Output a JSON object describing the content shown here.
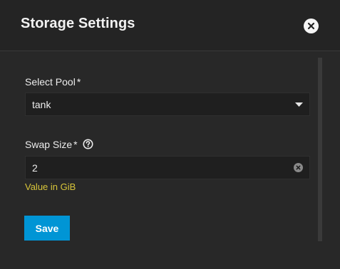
{
  "header": {
    "title": "Storage Settings",
    "close_icon": "close-circle-icon"
  },
  "form": {
    "pool": {
      "label": "Select Pool",
      "required_mark": "*",
      "value": "tank",
      "icon": "chevron-down-icon"
    },
    "swap": {
      "label": "Swap Size",
      "required_mark": "*",
      "value": "2",
      "hint": "Value in GiB",
      "help_icon": "question-circle-icon",
      "clear_icon": "clear-circle-icon"
    },
    "save_label": "Save"
  },
  "colors": {
    "background": "#282828",
    "header": "#242424",
    "accent": "#0095d5",
    "hint": "#d8c53a",
    "text": "#ededed"
  }
}
